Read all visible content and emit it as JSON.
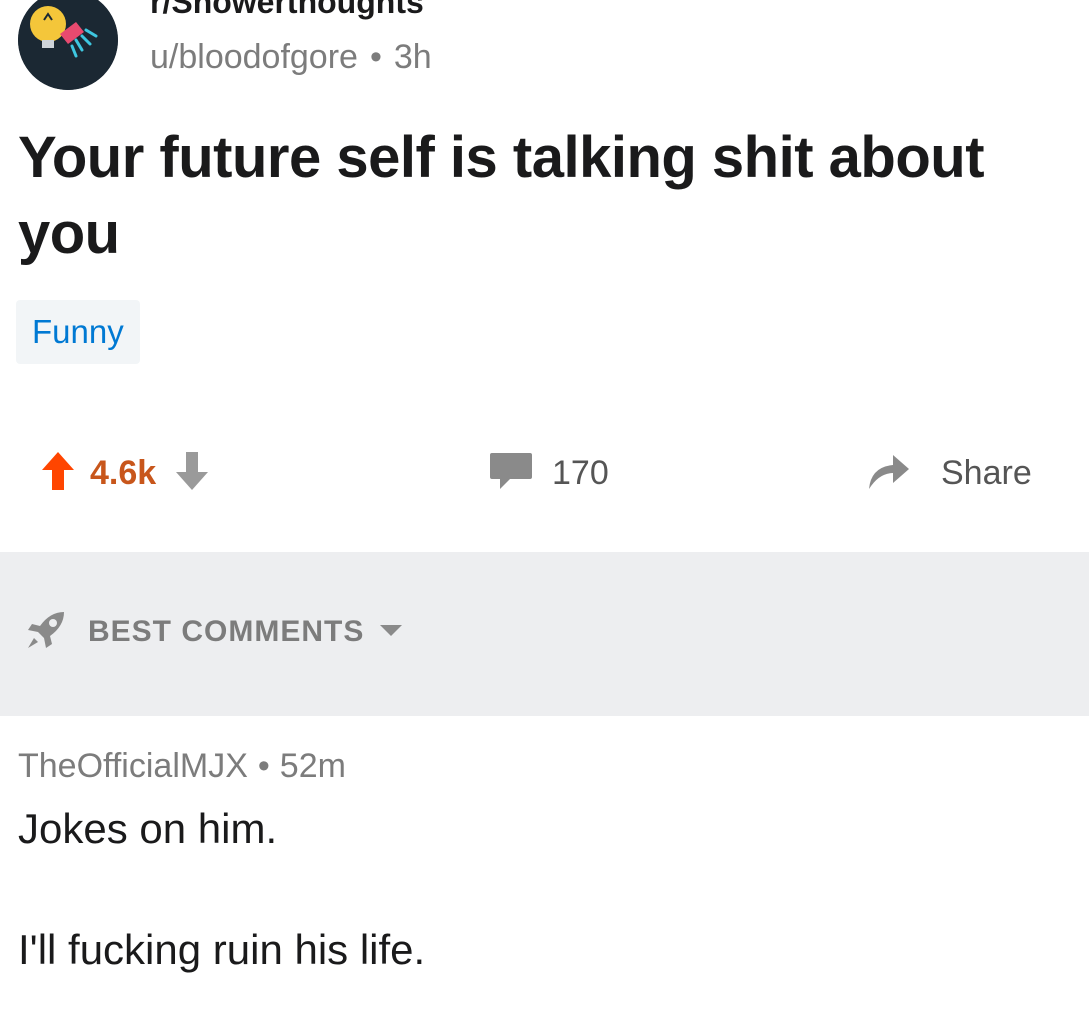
{
  "post": {
    "subreddit": "r/Showerthoughts",
    "author": "u/bloodofgore",
    "separator": "•",
    "age": "3h",
    "title": "Your future self is talking shit about you",
    "flair": "Funny",
    "score": "4.6k",
    "comment_count": "170",
    "share_label": "Share"
  },
  "sort": {
    "label": "BEST COMMENTS",
    "icon": "rocket-icon"
  },
  "comment": {
    "author": "TheOfficialMJX",
    "separator": "•",
    "age": "52m",
    "body_line1": "Jokes on him.",
    "body_line2": "I'll fucking ruin his life."
  },
  "colors": {
    "upvote": "#ff4500",
    "score": "#c8561b",
    "flair_text": "#0079d3",
    "muted": "#7c7c7c",
    "sort_bar_bg": "#edeef0"
  }
}
